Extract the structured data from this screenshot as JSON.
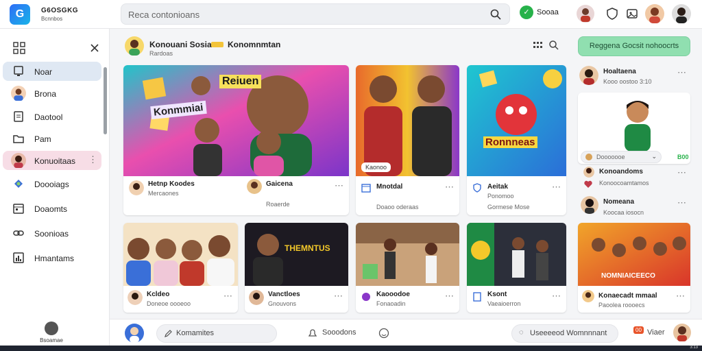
{
  "brand": {
    "logo_letter": "G",
    "title": "G6OSGKG",
    "subtitle": "Bcnnbos"
  },
  "search": {
    "value": "Reca contonioans"
  },
  "status": {
    "label": "Sooaa"
  },
  "sidebar": {
    "items": [
      {
        "label": "Noar",
        "icon": "monitor-icon",
        "state": "active"
      },
      {
        "label": "Brona",
        "icon": "avatar",
        "state": "normal"
      },
      {
        "label": "Daotool",
        "icon": "document-icon",
        "state": "normal"
      },
      {
        "label": "Pam",
        "icon": "folder-icon",
        "state": "normal"
      },
      {
        "label": "Konuoitaas",
        "icon": "avatar",
        "state": "highlighted"
      },
      {
        "label": "Doooiags",
        "icon": "puzzle-icon",
        "state": "normal"
      },
      {
        "label": "Doaomts",
        "icon": "calendar-icon",
        "state": "normal"
      },
      {
        "label": "Soonioas",
        "icon": "link-icon",
        "state": "normal"
      },
      {
        "label": "Hmantams",
        "icon": "stats-icon",
        "state": "normal"
      }
    ],
    "footer": "Bsoamae"
  },
  "channel": {
    "name": "Konouani Sosia",
    "name2": "Konomnmtan",
    "sub": "Rardoas"
  },
  "cta_label": "Reggena Gocsit nohoocrts",
  "cards": [
    {
      "banner_text": "Reiuen",
      "banner_text2": "Konmmiai",
      "title": "Hetnp Koodes",
      "sub": "Mercaones",
      "title2": "Gaicena",
      "sub2": "Roaerde"
    },
    {
      "title": "Mnotdal",
      "sub": "Doaoo oderaas",
      "badge": "Kaonoo"
    },
    {
      "banner_text": "Ronnneas",
      "title": "Aeitak",
      "sub": "Gormese Mose",
      "sub_small": "Ponomoo"
    },
    {
      "title": "Kcldeo",
      "sub": "Doneoe oooeoo"
    },
    {
      "banner_text": "THEMNTUS",
      "title": "Vanctloes",
      "sub": "Gnouvons"
    },
    {
      "title": "Kaooodoe",
      "sub": "Fonaoadin"
    },
    {
      "title": "Ksont",
      "sub": "Vaeaioerron"
    },
    {
      "banner_text": "NOMNIAICEECO",
      "title": "Konaecadt mmaal",
      "sub": "Paoolea roooecs"
    }
  ],
  "right_column": {
    "top": {
      "title": "Hoaltaena",
      "sub": "Kooo oostoo 3:10"
    },
    "feature_dropdown": "Dooooooe",
    "feature_value": "B00",
    "items": [
      {
        "title": "Konoandoms",
        "sub": "Konoocoamtamos"
      },
      {
        "title": "Nomeana",
        "sub": "Koocaa iosocn"
      }
    ]
  },
  "bottom": {
    "comment": "Komamites",
    "action": "Sooodons",
    "field": "Useeeeod Womnnnant",
    "badge": "00",
    "user_label": "Viaer",
    "clock": "3:13"
  },
  "colors": {
    "accent": "#2f6df6",
    "success": "#27b24a",
    "cta": "#90dfb0",
    "active_nav": "#dfe8f3",
    "highlight_nav": "#f7dde6"
  }
}
